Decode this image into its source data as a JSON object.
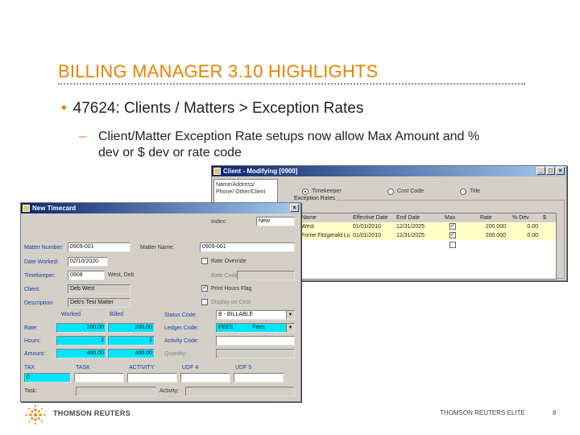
{
  "slide": {
    "title": "BILLING MANAGER 3.10 HIGHLIGHTS",
    "bullet": "47624: Clients / Matters > Exception Rates",
    "sub_bullet": "Client/Matter Exception Rate setups now allow Max Amount and % dev or $ dev or rate code",
    "page_number": "8"
  },
  "footer": {
    "logo_text": "THOMSON REUTERS",
    "right_text": "THOMSON REUTERS ELITE"
  },
  "client_window": {
    "title": "Client - Modifying [0900]",
    "left_list": [
      "Name/Address/",
      "Phone/ Other/Client"
    ],
    "radios": [
      "Timekeeper",
      "Cost Code",
      "Title"
    ],
    "group_title": "Exception Rates",
    "grid": {
      "headers": [
        "Name",
        "Effective Date",
        "End Date",
        "Max",
        "Rate",
        "% Dev",
        "$"
      ],
      "rows": [
        {
          "name": "West",
          "eff": "01/01/2010",
          "end": "12/31/2025",
          "max": "✓",
          "rate": "200.000",
          "dev": "0.00"
        },
        {
          "name": "Forne Fitzgerald Lu",
          "eff": "01/01/2010",
          "end": "12/31/2025",
          "max": "✓",
          "rate": "200.000",
          "dev": "0.00"
        }
      ]
    }
  },
  "timecard_window": {
    "title": "New Timecard",
    "index_label": "Index:",
    "index_value": "New",
    "matter_number_label": "Matter Number:",
    "matter_number_value": "0909-001",
    "matter_name_label": "Matter Name:",
    "matter_name_value": "0909-001",
    "date_worked_label": "Date Worked:",
    "date_worked_value": "02/10/2020",
    "timekeeper_label": "Timekeeper:",
    "timekeeper_code": "0908",
    "timekeeper_name": "West, Deb",
    "client_label": "Client:",
    "client_value": "Deb West",
    "description_label": "Description:",
    "description_value": "Deb's Test Matter",
    "rate_override_label": "Rate Override",
    "rate_code_label": "Rate Code:",
    "print_hours_label": "Print Hours Flag",
    "display_on_cost_label": "Display on Cost",
    "worked_label": "Worked",
    "billed_label": "Billed",
    "status_code_label": "Status Code:",
    "status_code_value": "B - BILLABLE",
    "ledger_code_label": "Ledger Code:",
    "ledger_code_value": "FEES",
    "ledger_code_desc": "Fees",
    "activity_code_label": "Activity Code:",
    "quantity_label": "Quantity:",
    "rate_label": "Rate:",
    "rate_worked": "200.00",
    "rate_billed": "200.00",
    "hours_label": "Hours:",
    "hours_worked": "2",
    "hours_billed": "2",
    "amount_label": "Amount:",
    "amount_worked": "400.00",
    "amount_billed": "400.00",
    "tax_label": "TAX",
    "tax_value": "0",
    "task_col_label": "TASK",
    "activity_col_label": "ACTIVITY",
    "udf4_label": "UDF 4",
    "udf5_label": "UDF 5",
    "task_label": "Task:",
    "activity_label": "Activity:"
  }
}
